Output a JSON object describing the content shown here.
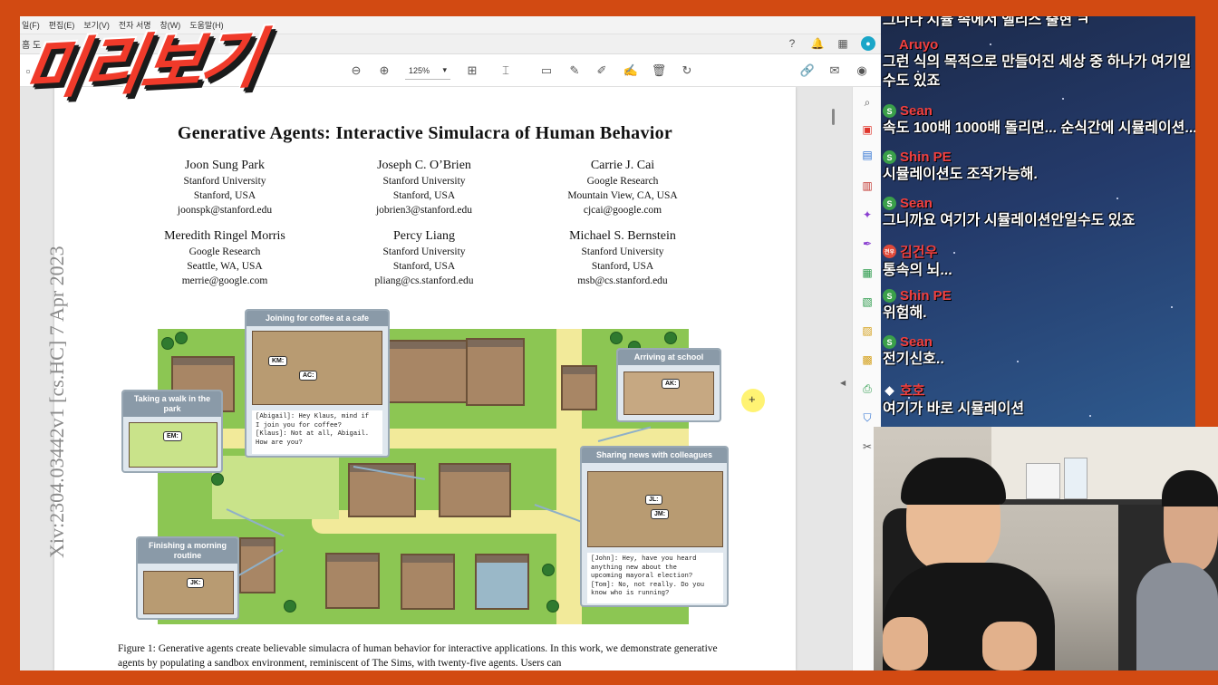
{
  "menu": [
    "일(F)",
    "편집(E)",
    "보기(V)",
    "전자 서명",
    "창(W)",
    "도움말(H)"
  ],
  "tab": {
    "label": "홈 도"
  },
  "toolbar": {
    "zoom": "125%"
  },
  "watermark": "미리보기",
  "paper": {
    "title": "Generative Agents: Interactive Simulacra of Human Behavior",
    "authors": [
      {
        "name": "Joon Sung Park",
        "affil": "Stanford University",
        "loc": "Stanford, USA",
        "email": "joonspk@stanford.edu"
      },
      {
        "name": "Joseph C. O’Brien",
        "affil": "Stanford University",
        "loc": "Stanford, USA",
        "email": "jobrien3@stanford.edu"
      },
      {
        "name": "Carrie J. Cai",
        "affil": "Google Research",
        "loc": "Mountain View, CA, USA",
        "email": "cjcai@google.com"
      },
      {
        "name": "Meredith Ringel Morris",
        "affil": "Google Research",
        "loc": "Seattle, WA, USA",
        "email": "merrie@google.com"
      },
      {
        "name": "Percy Liang",
        "affil": "Stanford University",
        "loc": "Stanford, USA",
        "email": "pliang@cs.stanford.edu"
      },
      {
        "name": "Michael S. Bernstein",
        "affil": "Stanford University",
        "loc": "Stanford, USA",
        "email": "msb@cs.stanford.edu"
      }
    ],
    "arxiv": "Xiv:2304.03442v1  [cs.HC]  7 Apr 2023",
    "caption": "Figure 1: Generative agents create believable simulacra of human behavior for interactive applications. In this work, we demonstrate generative agents by populating a sandbox environment, reminiscent of The Sims, with twenty-five agents. Users can",
    "callouts": {
      "cafe": {
        "title": "Joining for coffee at a cafe",
        "dialog": "[Abigail]: Hey Klaus, mind if\nI join you for coffee?\n[Klaus]: Not at all, Abigail.\nHow are you?",
        "b1": "KM:",
        "b2": "AC:"
      },
      "walk": {
        "title": "Taking a walk in the park",
        "b1": "EM:"
      },
      "school": {
        "title": "Arriving at school",
        "b1": "AK:"
      },
      "news": {
        "title": "Sharing news with colleagues",
        "dialog": "[John]: Hey, have you heard\nanything new about the\nupcoming mayoral election?\n[Tom]: No, not really. Do you\nknow who is running?",
        "b1": "JL:",
        "b2": "JM:"
      },
      "morning": {
        "title": "Finishing a morning routine",
        "b1": "JK:"
      }
    }
  },
  "chat": [
    {
      "user": "",
      "badge": "",
      "msg": "그나나 시뮬 속에서 앨리스 출현 ㅋ"
    },
    {
      "user": "Aruyo",
      "badge": "",
      "msg": "그런 식의 목적으로 만들어진 세상 중 하나가 여기일수도 있죠"
    },
    {
      "user": "Sean",
      "badge": "S",
      "msg": "속도 100배 1000배 돌리면... 순식간에 시뮬레이션..."
    },
    {
      "user": "Shin PE",
      "badge": "S",
      "msg": "시뮬레이션도 조작가능해."
    },
    {
      "user": "Sean",
      "badge": "S",
      "msg": "그니까요 여기가 시뮬레이션안일수도 있죠"
    },
    {
      "user": "김건우",
      "badge": "전우",
      "msg": "통속의 뇌..."
    },
    {
      "user": "Shin PE",
      "badge": "S",
      "msg": "위험해."
    },
    {
      "user": "Sean",
      "badge": "S",
      "msg": "전기신호.."
    },
    {
      "user": "호호",
      "badge": "◆",
      "msg": "여기가 바로 시뮬레이션"
    }
  ]
}
